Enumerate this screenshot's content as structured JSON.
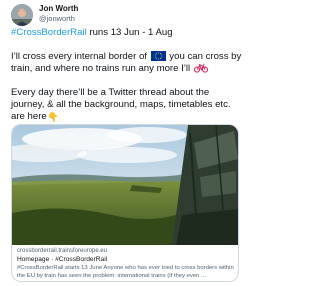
{
  "author": {
    "name": "Jon Worth",
    "handle": "@jonworth"
  },
  "tweet": {
    "hashtag": "#CrossBorderRail",
    "line1_rest": " runs 13 Jun - 1 Aug",
    "line2_start": "I’ll cross every internal border of ",
    "line2_end": " you can cross by",
    "line3": "train, and where no trains run any more I’ll ",
    "line4": "Every day there’ll be a Twitter thread about the",
    "line5": "journey, & all the background, maps, timetables etc.",
    "line6": "are here",
    "icons": {
      "flag": "eu-flag-icon",
      "bike": "bicycle-icon",
      "point_down": "backhand-index-pointing-down-icon"
    }
  },
  "card": {
    "domain": "crossborderrail.trainsforeurope.eu",
    "title": "Homepage · #CrossBorderRail",
    "description": "#CrossBorderRail starts 13 June Anyone who has ever tried to cross borders within the EU by train has seen the problem: international trains (if they even ..."
  },
  "colors": {
    "link": "#1d9bf0",
    "secondary_text": "#536471",
    "primary_text": "#0f1419",
    "border": "#cfd9de",
    "eu_blue": "#003399",
    "eu_gold": "#ffcc00",
    "bike_red": "#e0245e"
  }
}
